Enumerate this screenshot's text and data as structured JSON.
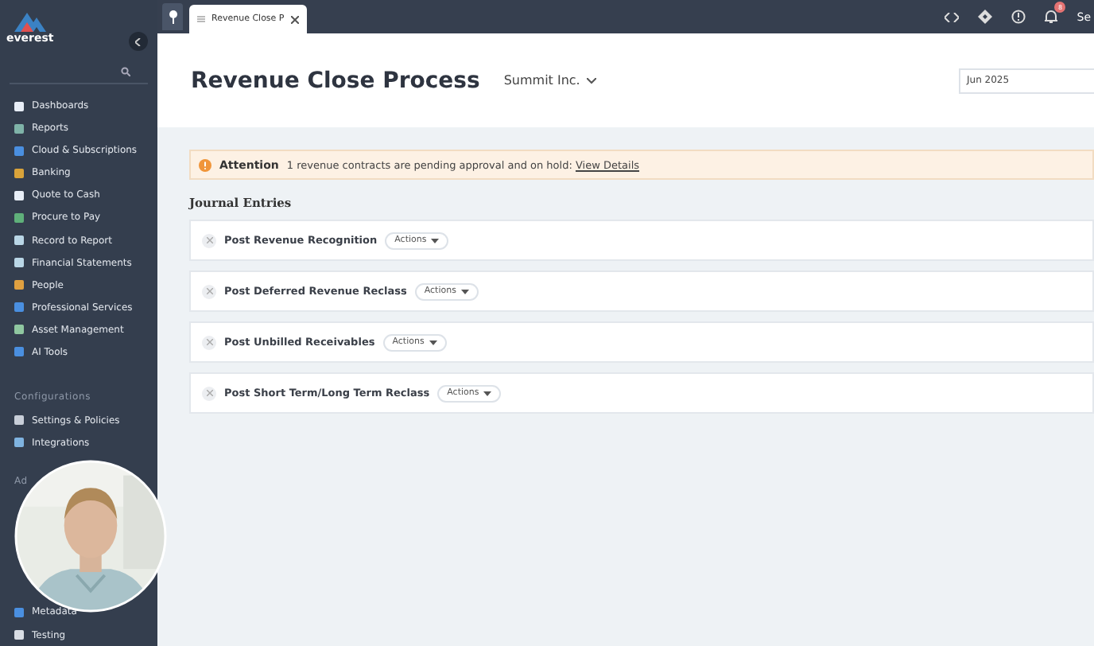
{
  "sidebar": {
    "brand": "everest",
    "items": [
      {
        "label": "Dashboards",
        "color": "#e8eef7"
      },
      {
        "label": "Reports",
        "color": "#7fb3a8"
      },
      {
        "label": "Cloud & Subscriptions",
        "color": "#4a8fe0"
      },
      {
        "label": "Banking",
        "color": "#d9a33a"
      },
      {
        "label": "Quote to Cash",
        "color": "#e8eef7"
      },
      {
        "label": "Procure to Pay",
        "color": "#5fb07a"
      },
      {
        "label": "Record to Report",
        "color": "#b9d6e6"
      },
      {
        "label": "Financial Statements",
        "color": "#b9d6e6"
      },
      {
        "label": "People",
        "color": "#e0a040"
      },
      {
        "label": "Professional Services",
        "color": "#4a8fe0"
      },
      {
        "label": "Asset Management",
        "color": "#8fc7a0"
      },
      {
        "label": "AI Tools",
        "color": "#4a8fe0"
      }
    ],
    "sections": [
      {
        "title": "Configurations",
        "items": [
          {
            "label": "Settings & Policies",
            "color": "#c8ced8"
          },
          {
            "label": "Integrations",
            "color": "#7fb3e0"
          }
        ]
      },
      {
        "title": "Ad",
        "items": [
          {
            "label": "Metadata",
            "color": "#4a8fe0"
          },
          {
            "label": "Testing",
            "color": "#d8dde4"
          }
        ]
      }
    ]
  },
  "topbar": {
    "tab": "Revenue Close P",
    "notification_count": "8",
    "user": "Se"
  },
  "header": {
    "title": "Revenue Close Process",
    "company": "Summit Inc.",
    "period": "Jun 2025"
  },
  "alert": {
    "label": "Attention",
    "message": "1 revenue contracts are pending approval and on hold:",
    "link": "View Details"
  },
  "journal": {
    "title": "Journal Entries",
    "entries": [
      {
        "name": "Post Revenue Recognition",
        "action": "Actions"
      },
      {
        "name": "Post Deferred Revenue Reclass",
        "action": "Actions"
      },
      {
        "name": "Post Unbilled Receivables",
        "action": "Actions"
      },
      {
        "name": "Post Short Term/Long Term Reclass",
        "action": "Actions"
      }
    ]
  }
}
